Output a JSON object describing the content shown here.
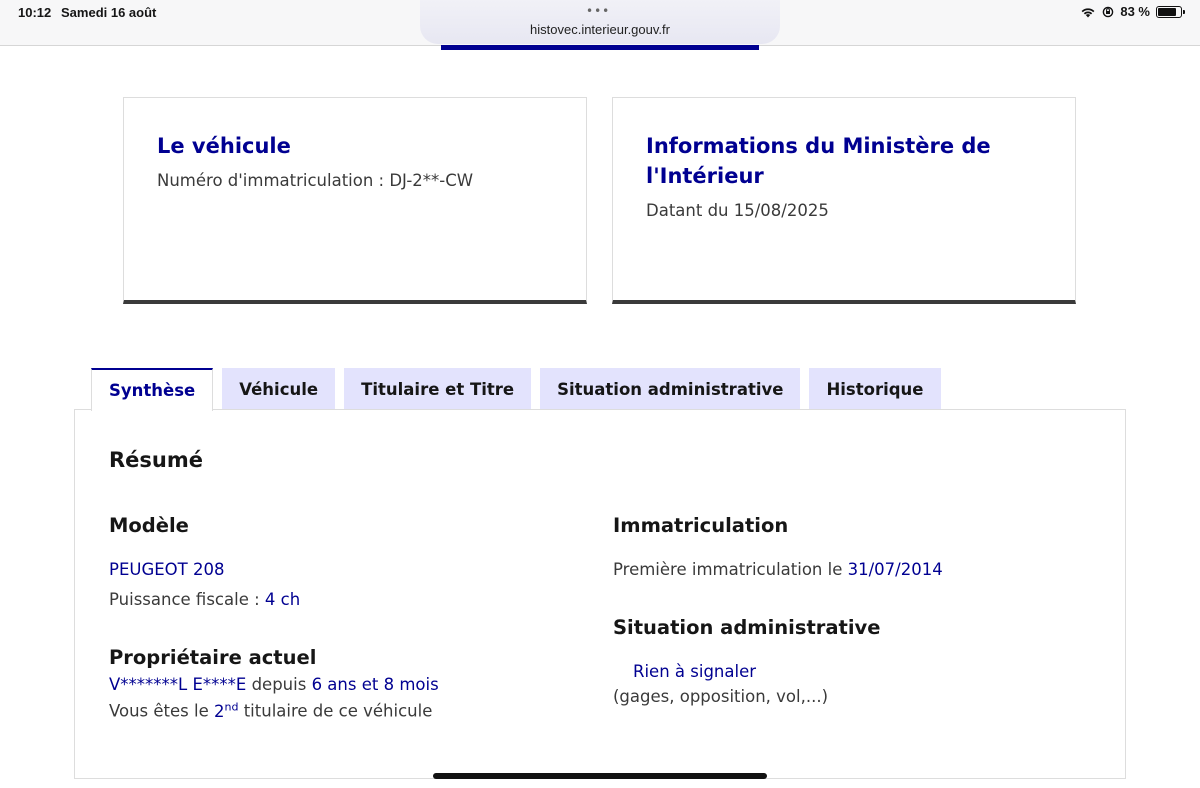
{
  "status": {
    "time": "10:12",
    "date": "Samedi 16 août",
    "url": "histovec.interieur.gouv.fr",
    "battery": "83 %",
    "battery_level": 0.83
  },
  "cards": {
    "vehicle": {
      "title": "Le véhicule",
      "plate_text": "Numéro d'immatriculation : DJ-2**-CW"
    },
    "ministry": {
      "title_line1": "Informations du Ministère de",
      "title_line2": "l'Intérieur",
      "date_text": "Datant du 15/08/2025"
    }
  },
  "tabs": [
    {
      "label": "Synthèse",
      "active": true
    },
    {
      "label": "Véhicule",
      "active": false
    },
    {
      "label": "Titulaire et Titre",
      "active": false
    },
    {
      "label": "Situation administrative",
      "active": false
    },
    {
      "label": "Historique",
      "active": false
    }
  ],
  "summary": {
    "title": "Résumé",
    "model": {
      "heading": "Modèle",
      "name": "PEUGEOT 208",
      "power_label": "Puissance fiscale : ",
      "power_value": "4 ch"
    },
    "owner": {
      "heading": "Propriétaire actuel",
      "name": "V*******L E****E",
      "since_label": " depuis ",
      "duration": "6 ans et 8 mois",
      "rank_prefix": "Vous êtes le ",
      "rank_num": "2",
      "rank_sup": "nd",
      "rank_suffix": " titulaire de ce véhicule"
    },
    "registration": {
      "heading": "Immatriculation",
      "label": "Première immatriculation le ",
      "date": "31/07/2014"
    },
    "admin": {
      "heading": "Situation administrative",
      "status": "Rien à signaler",
      "note": "(gages, opposition, vol,...)"
    }
  }
}
